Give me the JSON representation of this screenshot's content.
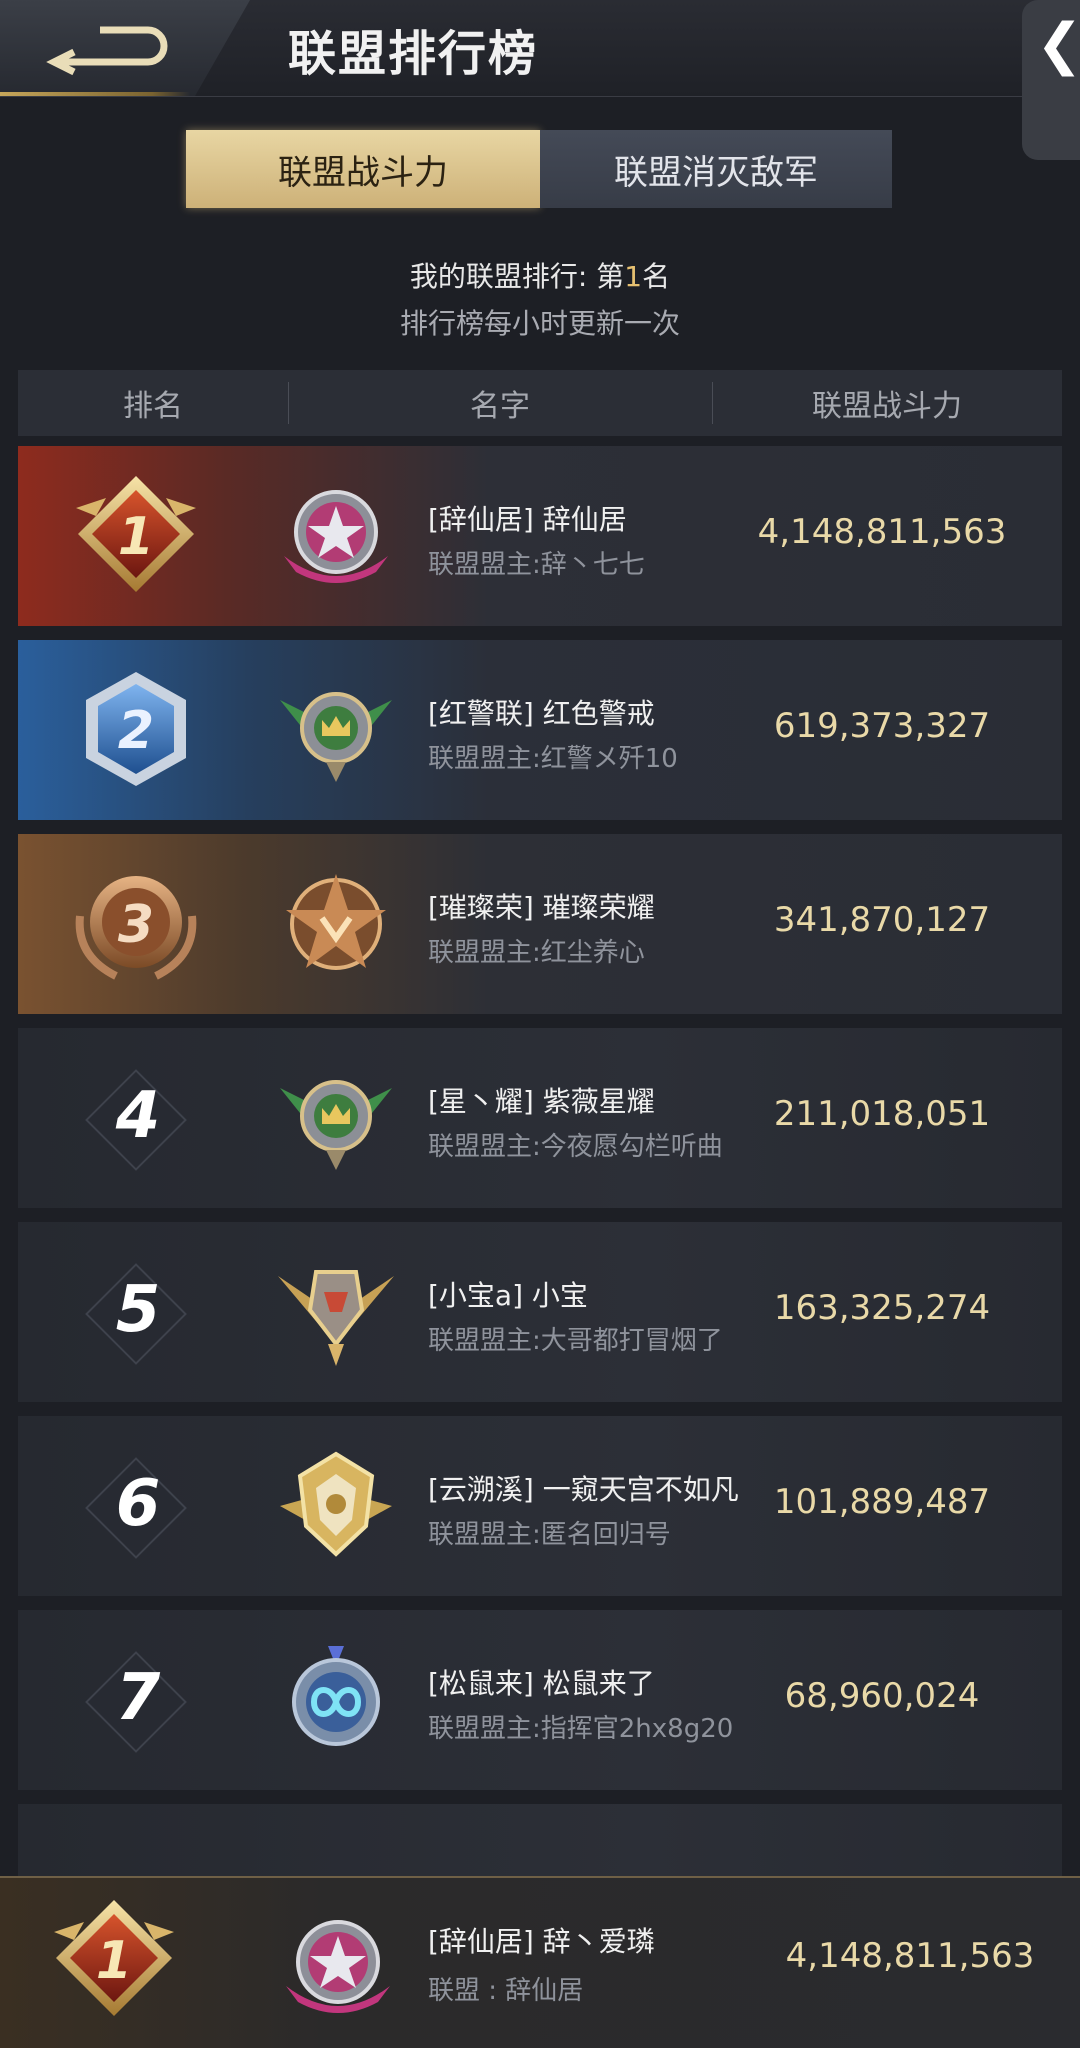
{
  "header": {
    "title": "联盟排行榜",
    "side_tab_glyph": "❮"
  },
  "tabs": [
    {
      "label": "联盟战斗力",
      "active": true
    },
    {
      "label": "联盟消灭敌军",
      "active": false
    }
  ],
  "my_rank": {
    "prefix": "我的联盟排行: 第",
    "rank": "1",
    "suffix": "名"
  },
  "update_note": "排行榜每小时更新一次",
  "columns": {
    "rank": "排名",
    "name": "名字",
    "power": "联盟战斗力"
  },
  "rows": [
    {
      "rank": "1",
      "name": "[辞仙居] 辞仙居",
      "leader": "联盟盟主:辞丶七七",
      "power": "4,148,811,563",
      "emblem": "pink-star-emblem"
    },
    {
      "rank": "2",
      "name": "[红警联] 红色警戒",
      "leader": "联盟盟主:红警メ歼10",
      "power": "619,373,327",
      "emblem": "green-winged-crown-emblem"
    },
    {
      "rank": "3",
      "name": "[璀璨荣] 璀璨荣耀",
      "leader": "联盟盟主:红尘养心",
      "power": "341,870,127",
      "emblem": "bronze-star-emblem"
    },
    {
      "rank": "4",
      "name": "[星丶耀] 紫薇星耀",
      "leader": "联盟盟主:今夜愿勾栏听曲",
      "power": "211,018,051",
      "emblem": "green-winged-crown-emblem"
    },
    {
      "rank": "5",
      "name": "[小宝a] 小宝",
      "leader": "联盟盟主:大哥都打冒烟了",
      "power": "163,325,274",
      "emblem": "gold-winged-helmet-emblem"
    },
    {
      "rank": "6",
      "name": "[云溯溪] 一窥天宫不如凡",
      "leader": "联盟盟主:匿名回归号",
      "power": "101,889,487",
      "emblem": "gold-shield-emblem"
    },
    {
      "rank": "7",
      "name": "[松鼠来] 松鼠来了",
      "leader": "联盟盟主:指挥官2hx8g20",
      "power": "68,960,024",
      "emblem": "blue-infinity-emblem"
    }
  ],
  "my_alliance": {
    "rank": "1",
    "name": "[辞仙居] 辞丶爱璘",
    "leader": "联盟 : 辞仙居",
    "power": "4,148,811,563",
    "emblem": "pink-star-emblem"
  },
  "colors": {
    "gold": "#e6c071",
    "power": "#e9d9a8",
    "rank1": "#8e2b1e",
    "rank2": "#2a5f9c",
    "rank3": "#7a5230"
  }
}
